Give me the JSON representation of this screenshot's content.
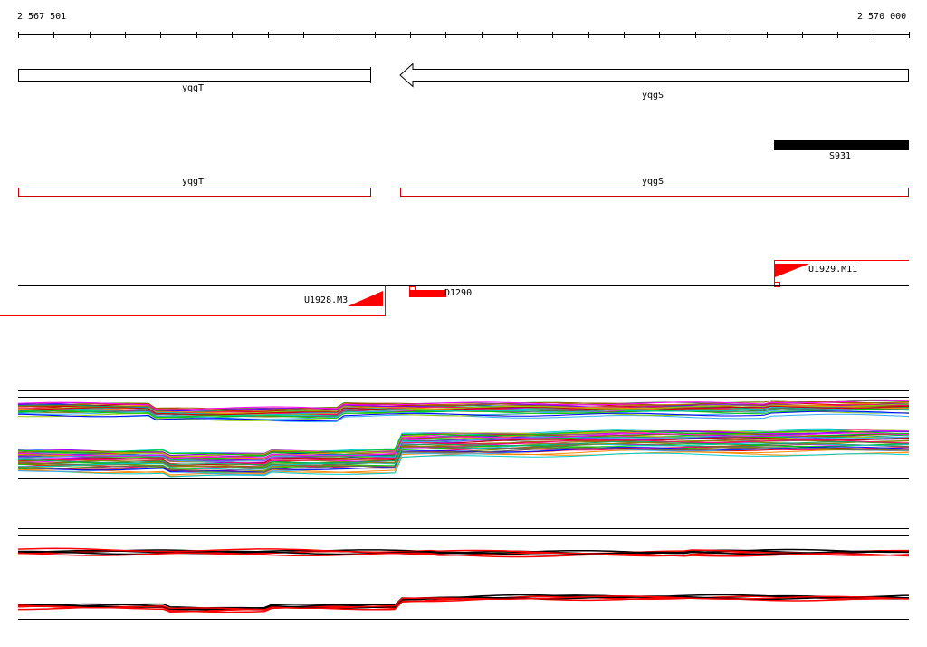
{
  "coordinates": {
    "start": "2 567 501",
    "end": "2 570 000"
  },
  "genes": [
    {
      "name": "yqgT",
      "strand": "+"
    },
    {
      "name": "yqgS",
      "strand": "-"
    }
  ],
  "cds_track": [
    {
      "name": "yqgT"
    },
    {
      "name": "yqgS"
    }
  ],
  "segment": {
    "name": "S931"
  },
  "features": [
    {
      "name": "U1928.M3"
    },
    {
      "name": "U1929.M11"
    },
    {
      "name": "D1290"
    }
  ],
  "colors": {
    "gene_outline": "#000000",
    "cds_outline": "#cc0000",
    "feature": "#ff0000",
    "segment": "#000000"
  }
}
